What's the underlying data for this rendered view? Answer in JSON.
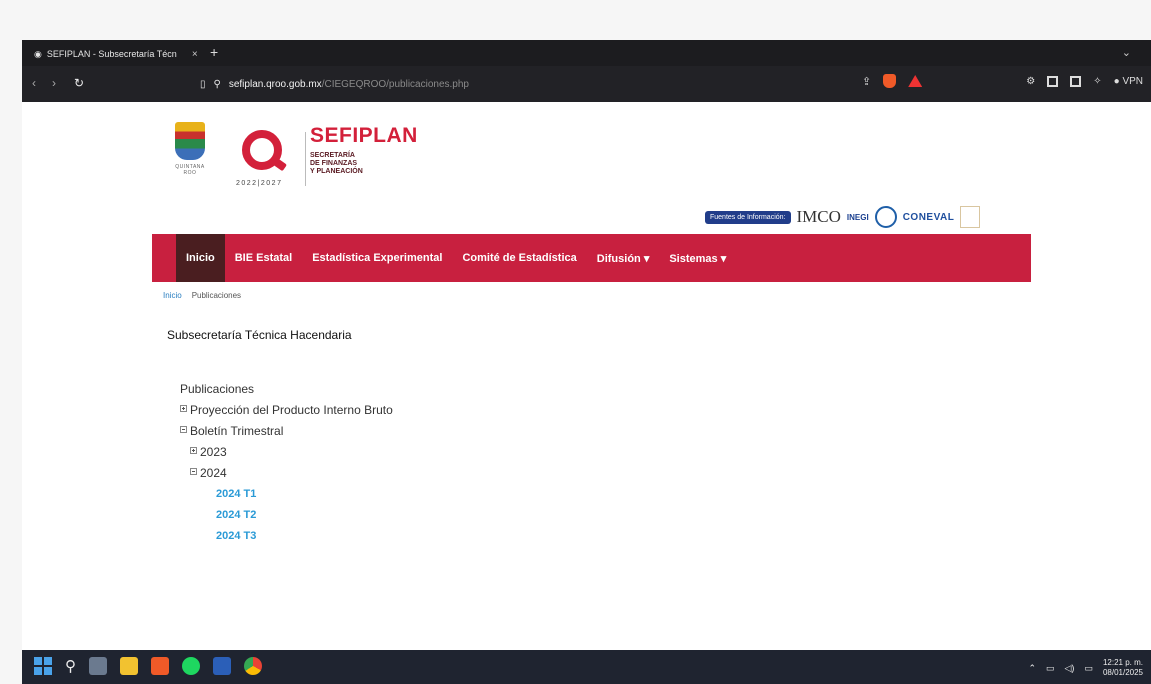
{
  "browser": {
    "tab_title": "SEFIPLAN - Subsecretaría Técn",
    "tab_close": "×",
    "new_tab": "+",
    "url_host": "sefiplan.qroo.gob.mx",
    "url_path": "/CIEGEQROO/publicaciones.php",
    "vpn_label": "VPN"
  },
  "header": {
    "brand": "SEFIPLAN",
    "brand_lines": [
      "SECRETARÍA",
      "DE FINANZAS",
      "Y PLANEACIÓN"
    ],
    "years": "2022|2027",
    "state_caption": "QUINTANA ROO",
    "sources_label": "Fuentes de Información:",
    "source_imco": "IMCO",
    "source_inegi": "INEGI",
    "source_coneval": "CONEVAL"
  },
  "nav": {
    "items": [
      "Inicio",
      "BIE Estatal",
      "Estadística Experimental",
      "Comité de Estadística",
      "Difusión ▾",
      "Sistemas ▾"
    ]
  },
  "breadcrumb": {
    "home": "Inicio",
    "current": "Publicaciones"
  },
  "main": {
    "heading": "Subsecretaría Técnica Hacendaria",
    "tree_root": "Publicaciones",
    "item_pib": "Proyección del Producto Interno Bruto",
    "item_boletin": "Boletín Trimestral",
    "year_2023": "2023",
    "year_2024": "2024",
    "docs": [
      "2024 T1",
      "2024 T2",
      "2024 T3"
    ]
  },
  "taskbar": {
    "time": "12:21 p. m.",
    "date": "08/01/2025"
  },
  "colors": {
    "nav_bg": "#c8203f",
    "nav_active": "#4a1e20",
    "brand_red": "#d3203a",
    "link_blue": "#2a9ad6"
  }
}
